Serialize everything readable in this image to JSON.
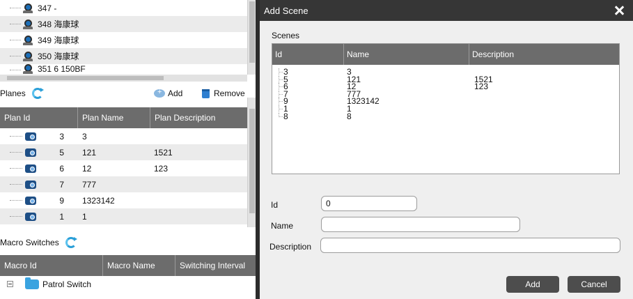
{
  "camera_list": {
    "items": [
      {
        "label": "347 -"
      },
      {
        "label": "348 海康球"
      },
      {
        "label": "349 海康球"
      },
      {
        "label": "350 海康球"
      },
      {
        "label": "351 6 150BF"
      }
    ]
  },
  "planes": {
    "title": "Planes",
    "add_label": "Add",
    "remove_label": "Remove",
    "columns": [
      "Plan Id",
      "Plan Name",
      "Plan Description"
    ],
    "rows": [
      {
        "id": "3",
        "name": "3",
        "desc": ""
      },
      {
        "id": "5",
        "name": "121",
        "desc": "1521"
      },
      {
        "id": "6",
        "name": "12",
        "desc": "123"
      },
      {
        "id": "7",
        "name": "777",
        "desc": ""
      },
      {
        "id": "9",
        "name": "1323142",
        "desc": ""
      },
      {
        "id": "1",
        "name": "1",
        "desc": ""
      }
    ]
  },
  "macro": {
    "title": "Macro Switches",
    "columns": [
      "Macro Id",
      "Macro Name",
      "Switching Interval"
    ],
    "rows": [
      {
        "label": "Patrol Switch"
      }
    ]
  },
  "dialog": {
    "title": "Add Scene",
    "scenes_label": "Scenes",
    "columns": [
      "Id",
      "Name",
      "Description"
    ],
    "rows": [
      {
        "id": "3",
        "name": "3",
        "desc": ""
      },
      {
        "id": "5",
        "name": "121",
        "desc": "1521"
      },
      {
        "id": "6",
        "name": "12",
        "desc": "123"
      },
      {
        "id": "7",
        "name": "777",
        "desc": ""
      },
      {
        "id": "9",
        "name": "1323142",
        "desc": ""
      },
      {
        "id": "1",
        "name": "1",
        "desc": ""
      },
      {
        "id": "8",
        "name": "8",
        "desc": ""
      }
    ],
    "id_label": "Id",
    "id_value": "0",
    "name_label": "Name",
    "name_value": "",
    "description_label": "Description",
    "description_value": "",
    "add_button": "Add",
    "cancel_button": "Cancel"
  }
}
